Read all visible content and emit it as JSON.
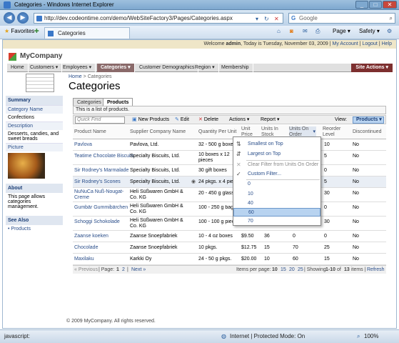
{
  "window": {
    "title": "Categories - Windows Internet Explorer"
  },
  "browser": {
    "url": "http://dev.codeontime.com/demo/WebSiteFactory3/Pages/Categories.aspx",
    "search_placeholder": "Google",
    "favorites_label": "Favorites",
    "tab_title": "Categories",
    "page_menu": "Page",
    "safety_menu": "Safety"
  },
  "header": {
    "welcome_prefix": "Welcome ",
    "user": "admin",
    "welcome_suffix": ", Today is Tuesday, November 03, 2009 | ",
    "my_account": "My Account",
    "logout": "Logout",
    "help": "Help",
    "brand": "MyCompany"
  },
  "menu": {
    "items": [
      "Home",
      "Customers",
      "Employees",
      "Categories",
      "Customer Demographics",
      "Region",
      "Membership"
    ],
    "site_actions": "Site Actions"
  },
  "breadcrumb": {
    "home": "Home",
    "sep": ">",
    "current": "Categories"
  },
  "page_title": "Categories",
  "sidebar": {
    "summary_title": "Summary",
    "category_name_label": "Category Name",
    "category_name_value": "Confections",
    "description_label": "Description",
    "description_value": "Desserts, candies, and sweet breads",
    "picture_label": "Picture",
    "about_title": "About",
    "about_text": "This page allows categories management.",
    "seealso_title": "See Also",
    "seealso_link": "Products"
  },
  "tabs": [
    "Categories",
    "Products"
  ],
  "list_desc": "This is a list of products.",
  "toolbar": {
    "quick_find": "Quick Find",
    "new_products": "New Products",
    "edit": "Edit",
    "delete": "Delete",
    "actions": "Actions",
    "report": "Report",
    "view_label": "View:",
    "view_value": "Products"
  },
  "columns": [
    "Product Name",
    "Supplier Company Name",
    "Quantity Per Unit",
    "Unit Price",
    "Units In Stock",
    "Units On Order",
    "Reorder Level",
    "Discontinued"
  ],
  "rows": [
    {
      "name": "Pavlova",
      "supplier": "Pavlova, Ltd.",
      "qty": "32 - 500 g boxes",
      "price": "",
      "stock": "",
      "order": "",
      "reorder": "10",
      "disc": "No"
    },
    {
      "name": "Teatime Chocolate Biscuits",
      "supplier": "Specialty Biscuits, Ltd.",
      "qty": "10 boxes x 12 pieces",
      "price": "",
      "stock": "",
      "order": "",
      "reorder": "5",
      "disc": "No"
    },
    {
      "name": "Sir Rodney's Marmalade",
      "supplier": "Specialty Biscuits, Ltd.",
      "qty": "30 gift boxes",
      "price": "",
      "stock": "",
      "order": "",
      "reorder": "0",
      "disc": "No"
    },
    {
      "name": "Sir Rodney's Scones",
      "supplier": "Specialty Biscuits, Ltd.",
      "qty": "24 pkgs. x 4 pieces",
      "price": "",
      "stock": "",
      "order": "",
      "reorder": "5",
      "disc": "No"
    },
    {
      "name": "NuNuCa Nuß-Nougat-Creme",
      "supplier": "Heli Süßwaren GmbH & Co. KG",
      "qty": "20 - 450 g glasses",
      "price": "",
      "stock": "",
      "order": "",
      "reorder": "30",
      "disc": "No"
    },
    {
      "name": "Gumbär Gummibärchen",
      "supplier": "Heli Süßwaren GmbH & Co. KG",
      "qty": "100 - 250 g bags",
      "price": "",
      "stock": "",
      "order": "",
      "reorder": "0",
      "disc": "No"
    },
    {
      "name": "Schoggi Schokolade",
      "supplier": "Heli Süßwaren GmbH & Co. KG",
      "qty": "100 - 100 g pieces",
      "price": "",
      "stock": "",
      "order": "",
      "reorder": "30",
      "disc": "No"
    },
    {
      "name": "Zaanse koeken",
      "supplier": "Zaanse Snoepfabriek",
      "qty": "10 - 4 oz boxes",
      "price": "$9.50",
      "stock": "36",
      "order": "0",
      "reorder": "0",
      "disc": "No"
    },
    {
      "name": "Chocolade",
      "supplier": "Zaanse Snoepfabriek",
      "qty": "10 pkgs.",
      "price": "$12.75",
      "stock": "15",
      "order": "70",
      "reorder": "25",
      "disc": "No"
    },
    {
      "name": "Maxilaku",
      "supplier": "Karkki Oy",
      "qty": "24 - 50 g pkgs.",
      "price": "$20.00",
      "stock": "10",
      "order": "60",
      "reorder": "15",
      "disc": "No"
    }
  ],
  "pager": {
    "prev": "« Previous",
    "page_label": "| Page:",
    "p1": "1",
    "p2": "2",
    "next": "Next »",
    "items_label": "Items per page:",
    "s10": "10",
    "s15": "15",
    "s20": "20",
    "s25": "25",
    "showing": "| Showing",
    "range": "1-10",
    "of": "of",
    "total": "13",
    "items": "items |",
    "refresh": "Refresh"
  },
  "dropdown": {
    "smallest": "Smallest on Top",
    "largest": "Largest on Top",
    "clear": "Clear Filter from Units On Order",
    "custom": "Custom Filter...",
    "values": [
      "0",
      "10",
      "40",
      "60",
      "70"
    ],
    "selected": "60"
  },
  "footer": "© 2009 MyCompany. All rights reserved.",
  "status": {
    "left": "javascript:",
    "zone": "Internet | Protected Mode: On",
    "zoom": "100%"
  }
}
